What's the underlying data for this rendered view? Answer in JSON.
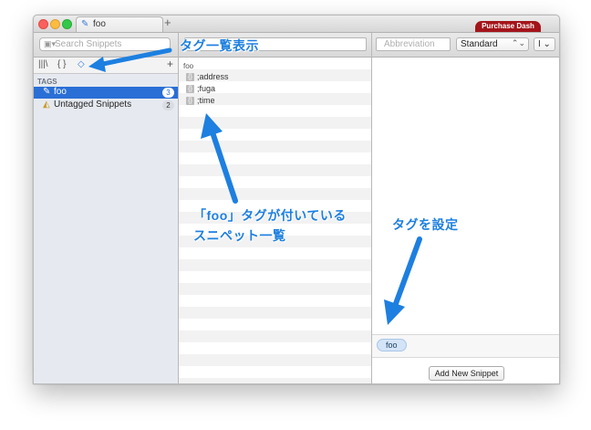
{
  "window": {
    "tab_title": "foo",
    "new_tab_label": "+",
    "purchase_label": "Purchase Dash"
  },
  "toolbar": {
    "search_placeholder": "Search Snippets",
    "abbreviation_placeholder": "Abbreviation",
    "mode_value": "Standard",
    "mode_arrow": "⌃⌄",
    "cursor_label": "I ⌄"
  },
  "sidebar": {
    "tools": [
      "|||\\",
      "{ }",
      "◇",
      "+"
    ],
    "section_header": "TAGS",
    "tags": [
      {
        "label": "foo",
        "count": "3",
        "selected": true
      },
      {
        "label": "Untagged Snippets",
        "count": "2",
        "selected": false
      }
    ]
  },
  "snippets": {
    "group_label": "foo",
    "items": [
      {
        "label": ";address"
      },
      {
        "label": ";fuga"
      },
      {
        "label": ";time"
      }
    ]
  },
  "editor": {
    "tags": [
      "foo"
    ],
    "add_button": "Add New Snippet"
  },
  "annotations": {
    "tag_list": "タグ一覧表示",
    "snippet_list_line1": "「foo」タグが付いている",
    "snippet_list_line2": "スニペット一覧",
    "set_tag": "タグを設定"
  },
  "colors": {
    "selection": "#2a6fd6",
    "annotation": "#1d7fe0",
    "purchase": "#a3141a"
  }
}
